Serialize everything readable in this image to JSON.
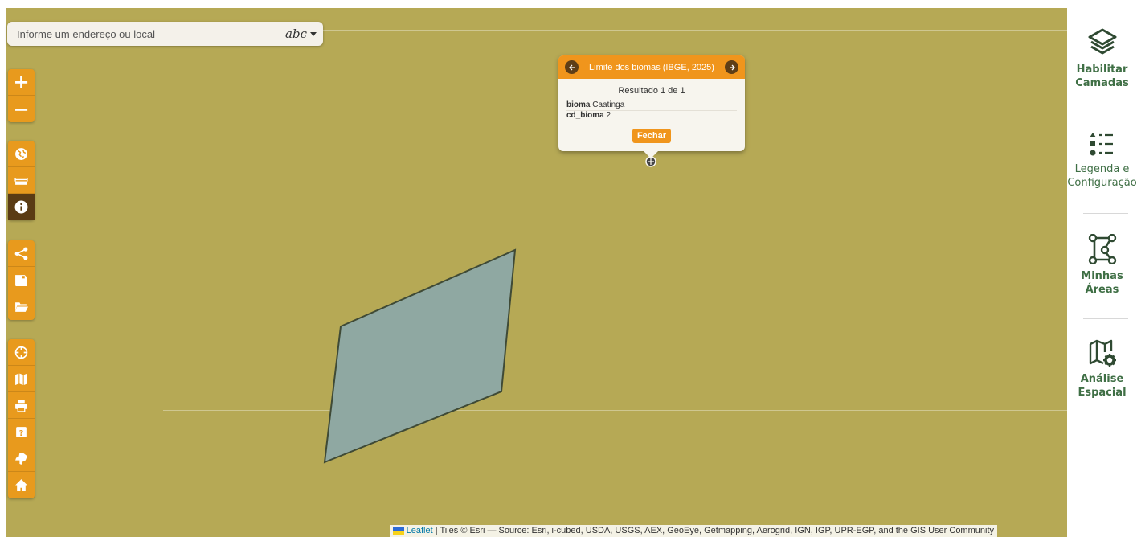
{
  "search": {
    "placeholder": "Informe um endereço ou local",
    "mode_label": "abc"
  },
  "toolbar": {
    "zoom_in": "+",
    "zoom_out": "−"
  },
  "popup": {
    "title": "Limite dos biomas (IBGE, 2025)",
    "result": "Resultado 1 de 1",
    "attributes": [
      {
        "key": "bioma",
        "value": "Caatinga"
      },
      {
        "key": "cd_bioma",
        "value": "2"
      }
    ],
    "close_label": "Fechar"
  },
  "attribution": {
    "leaflet": "Leaflet",
    "text": "| Tiles © Esri — Source: Esri, i-cubed, USDA, USGS, AEX, GeoEye, Getmapping, Aerogrid, IGN, IGP, UPR-EGP, and the GIS User Community"
  },
  "sidebar": {
    "items": [
      {
        "line1": "Habilitar",
        "line2": "Camadas"
      },
      {
        "line1": "Legenda e",
        "line2": "Configuração"
      },
      {
        "line1": "Minhas",
        "line2": "Áreas"
      },
      {
        "line1": "Análise",
        "line2": "Espacial"
      }
    ]
  },
  "colors": {
    "map_background": "#b6a955",
    "polygon_fill": "#8fa8a2",
    "accent": "#e89a1d",
    "active_button": "#5a3b14",
    "sidebar_text": "#3f6f45"
  }
}
